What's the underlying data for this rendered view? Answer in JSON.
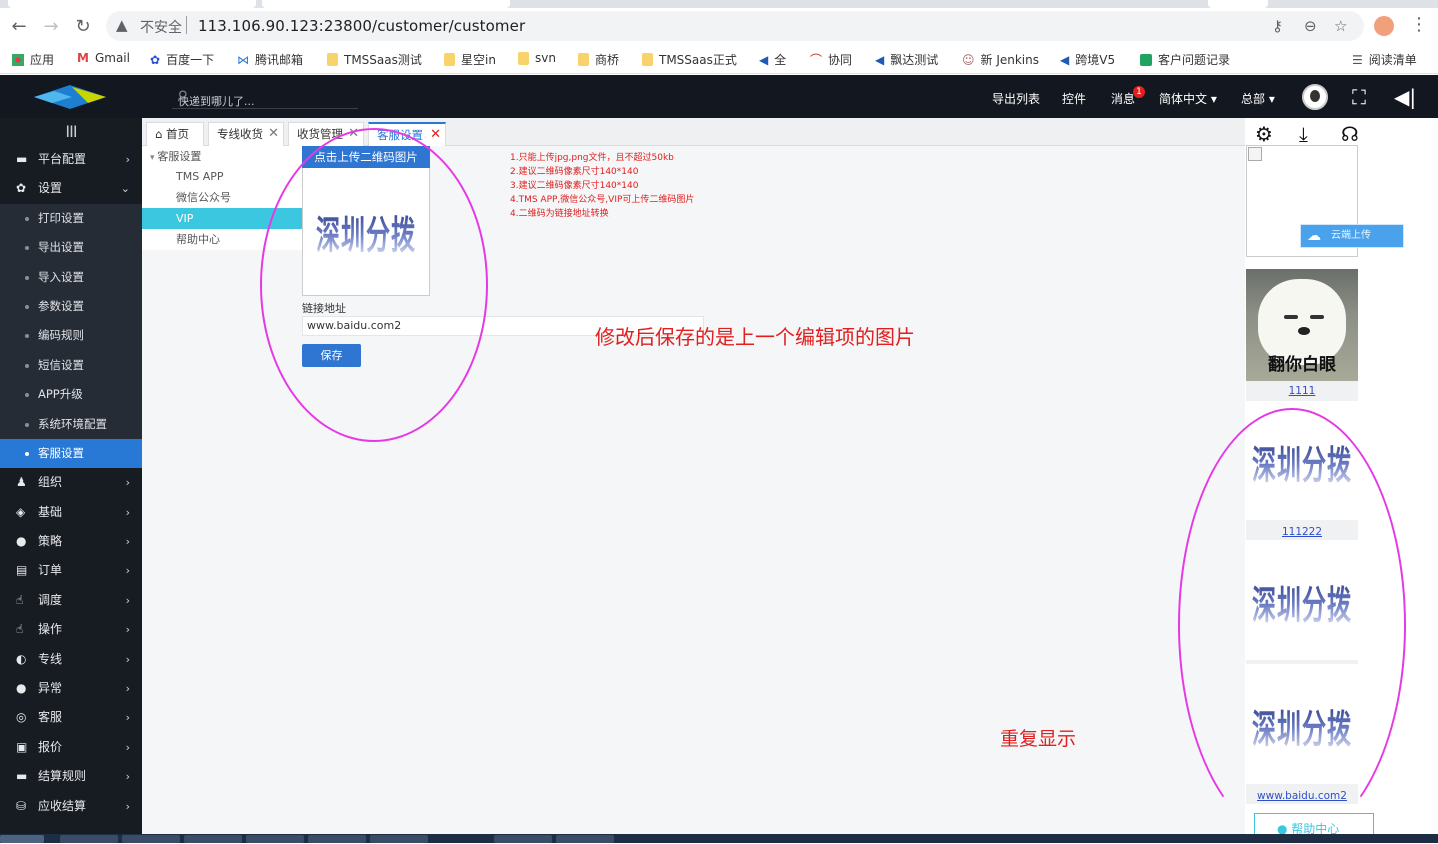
{
  "browser": {
    "insecure_label": "不安全",
    "url": "113.106.90.123:23800/customer/customer",
    "bookmarks": [
      "应用",
      "Gmail",
      "百度一下",
      "腾讯邮箱",
      "TMSSaas测试",
      "星空in",
      "svn",
      "商桥",
      "TMSSaas正式",
      "全",
      "协同",
      "飘达测试",
      "新 Jenkins",
      "跨境V5",
      "客户问题记录"
    ],
    "reading_list": "阅读清单"
  },
  "header": {
    "search_placeholder": "快递到哪儿了...",
    "export_list": "导出列表",
    "widgets": "控件",
    "messages": "消息",
    "message_count": "1",
    "language": "简体中文 ▾",
    "org": "总部 ▾"
  },
  "sidebar": {
    "toggle": "III",
    "top_items": [
      {
        "label": "平台配置",
        "icon": "monitor-icon",
        "glyph": "▬",
        "arrow": "›"
      },
      {
        "label": "设置",
        "icon": "gear-icon",
        "glyph": "✿",
        "arrow": "⌄"
      }
    ],
    "sub_items": [
      "打印设置",
      "导出设置",
      "导入设置",
      "参数设置",
      "编码规则",
      "短信设置",
      "APP升级",
      "系统环境配置",
      "客服设置"
    ],
    "active_sub": "客服设置",
    "bottom_items": [
      {
        "label": "组织",
        "icon": "people-icon",
        "glyph": "♟"
      },
      {
        "label": "基础",
        "icon": "layers-icon",
        "glyph": "◈"
      },
      {
        "label": "策略",
        "icon": "chat-icon",
        "glyph": "●"
      },
      {
        "label": "订单",
        "icon": "list-icon",
        "glyph": "▤"
      },
      {
        "label": "调度",
        "icon": "hand-icon",
        "glyph": "☝"
      },
      {
        "label": "操作",
        "icon": "hand-icon",
        "glyph": "☝"
      },
      {
        "label": "专线",
        "icon": "contrast-icon",
        "glyph": "◐"
      },
      {
        "label": "异常",
        "icon": "alert-icon",
        "glyph": "●"
      },
      {
        "label": "客服",
        "icon": "headset-icon",
        "glyph": "◎"
      },
      {
        "label": "报价",
        "icon": "document-icon",
        "glyph": "▣"
      },
      {
        "label": "结算规则",
        "icon": "monitor-icon",
        "glyph": "▬"
      },
      {
        "label": "应收结算",
        "icon": "coins-icon",
        "glyph": "⛁"
      }
    ]
  },
  "tabs": [
    {
      "label": "⌂ 首页",
      "closable": false
    },
    {
      "label": "专线收货",
      "closable": true
    },
    {
      "label": "收货管理",
      "closable": true
    },
    {
      "label": "客服设置",
      "closable": true,
      "active": true
    }
  ],
  "tree": {
    "root": "客服设置",
    "children": [
      "TMS APP",
      "微信公众号",
      "VIP",
      "帮助中心"
    ],
    "selected": "VIP"
  },
  "form": {
    "upload_button": "点击上传二维码图片",
    "image_text": "深圳分拨",
    "link_label": "链接地址",
    "link_value": "www.baidu.com2",
    "save_button": "保存",
    "rules": [
      "1.只能上传jpg,png文件，且不超过50kb",
      "2.建议二维码像素尺寸140*140",
      "3.建议二维码像素尺寸140*140",
      "4.TMS APP,微信公众号,VIP可上传二维码图片",
      "4.二维码为链接地址转换"
    ]
  },
  "annotations": {
    "note1": "修改后保存的是上一个编辑项的图片",
    "note2": "重复显示"
  },
  "right_panel": {
    "cloud_upload": "云端上传",
    "bear_caption": "翻你白眼",
    "cards": [
      {
        "label": "1111"
      },
      {
        "image_text": "深圳分拨",
        "label": "111222"
      },
      {
        "image_text": "深圳分拨",
        "label": ""
      },
      {
        "image_text": "深圳分拨",
        "label": "www.baidu.com2"
      }
    ],
    "help": "● 帮助中心"
  },
  "colors": {
    "accent": "#2f76d2",
    "tree_active": "#3bc7e0",
    "annotation": "#e02020",
    "ring": "#e639e6"
  }
}
